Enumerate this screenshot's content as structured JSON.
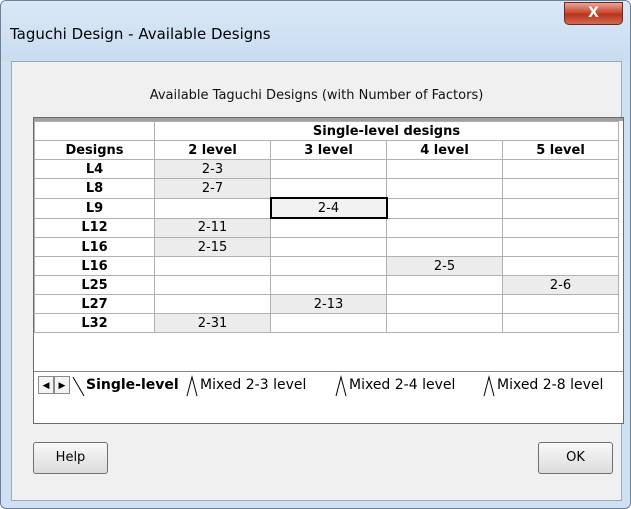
{
  "window": {
    "title": "Taguchi Design - Available Designs",
    "close_glyph": "X"
  },
  "caption": "Available Taguchi Designs (with Number of Factors)",
  "grid": {
    "group_header": "Single-level designs",
    "columns": [
      "Designs",
      "2 level",
      "3 level",
      "4 level",
      "5 level"
    ],
    "rows": [
      {
        "design": "L4",
        "cells": [
          "2-3",
          "",
          "",
          ""
        ]
      },
      {
        "design": "L8",
        "cells": [
          "2-7",
          "",
          "",
          ""
        ]
      },
      {
        "design": "L9",
        "cells": [
          "",
          "2-4",
          "",
          ""
        ]
      },
      {
        "design": "L12",
        "cells": [
          "2-11",
          "",
          "",
          ""
        ]
      },
      {
        "design": "L16",
        "cells": [
          "2-15",
          "",
          "",
          ""
        ]
      },
      {
        "design": "L16",
        "cells": [
          "",
          "",
          "2-5",
          ""
        ]
      },
      {
        "design": "L25",
        "cells": [
          "",
          "",
          "",
          "2-6"
        ]
      },
      {
        "design": "L27",
        "cells": [
          "",
          "2-13",
          "",
          ""
        ]
      },
      {
        "design": "L32",
        "cells": [
          "2-31",
          "",
          "",
          ""
        ]
      }
    ],
    "selected_cell": {
      "row": 2,
      "col": 1
    }
  },
  "tabs": [
    "Single-level",
    "Mixed 2-3 level",
    "Mixed 2-4 level",
    "Mixed 2-8 level"
  ],
  "active_tab": 0,
  "buttons": {
    "help": "Help",
    "ok": "OK"
  },
  "colors": {
    "filled_cell": "#ececec",
    "title_bar": "#cfe0f3",
    "close_button": "#c8452d"
  }
}
